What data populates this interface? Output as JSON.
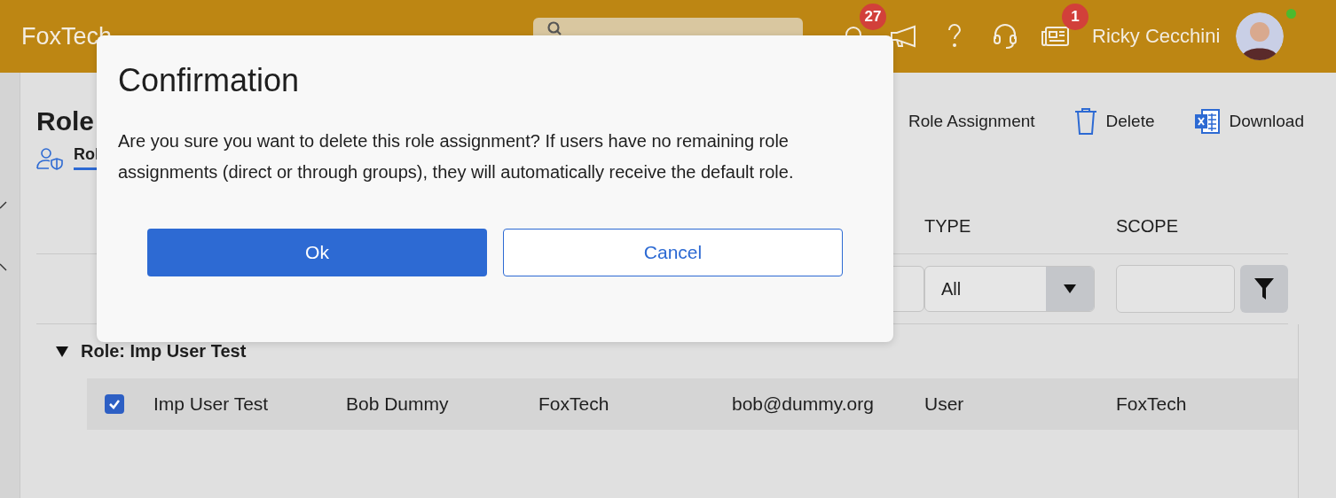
{
  "header": {
    "logo": "FoxTech",
    "notifications_badge": "27",
    "news_badge": "1",
    "user_name": "Ricky Cecchini",
    "user_online": true
  },
  "page": {
    "title": "Role",
    "tabs": [
      {
        "label": "Rol",
        "selected": true
      }
    ],
    "toolbar": [
      {
        "kind": "add",
        "label": "Role Assignment"
      },
      {
        "kind": "delete",
        "label": "Delete"
      },
      {
        "kind": "excel",
        "label": "Download"
      }
    ]
  },
  "table": {
    "columns": [
      {
        "label": "TYPE"
      },
      {
        "label": "SCOPE"
      }
    ],
    "type_filter": {
      "value": "All"
    },
    "groups": [
      {
        "label": "Role: Imp User Test",
        "expanded": true,
        "rows": [
          {
            "selected": true,
            "cells": [
              "Imp User Test",
              "Bob Dummy",
              "FoxTech",
              "bob@dummy.org",
              "User",
              "FoxTech"
            ]
          }
        ]
      }
    ]
  },
  "dialog": {
    "title": "Confirmation",
    "message": "Are you sure you want to delete this role assignment? If users have no remaining role assignments (direct or through groups), they will automatically receive the default role.",
    "buttons": [
      {
        "kind": "primary",
        "label": "Ok"
      },
      {
        "kind": "secondary",
        "label": "Cancel"
      }
    ]
  }
}
